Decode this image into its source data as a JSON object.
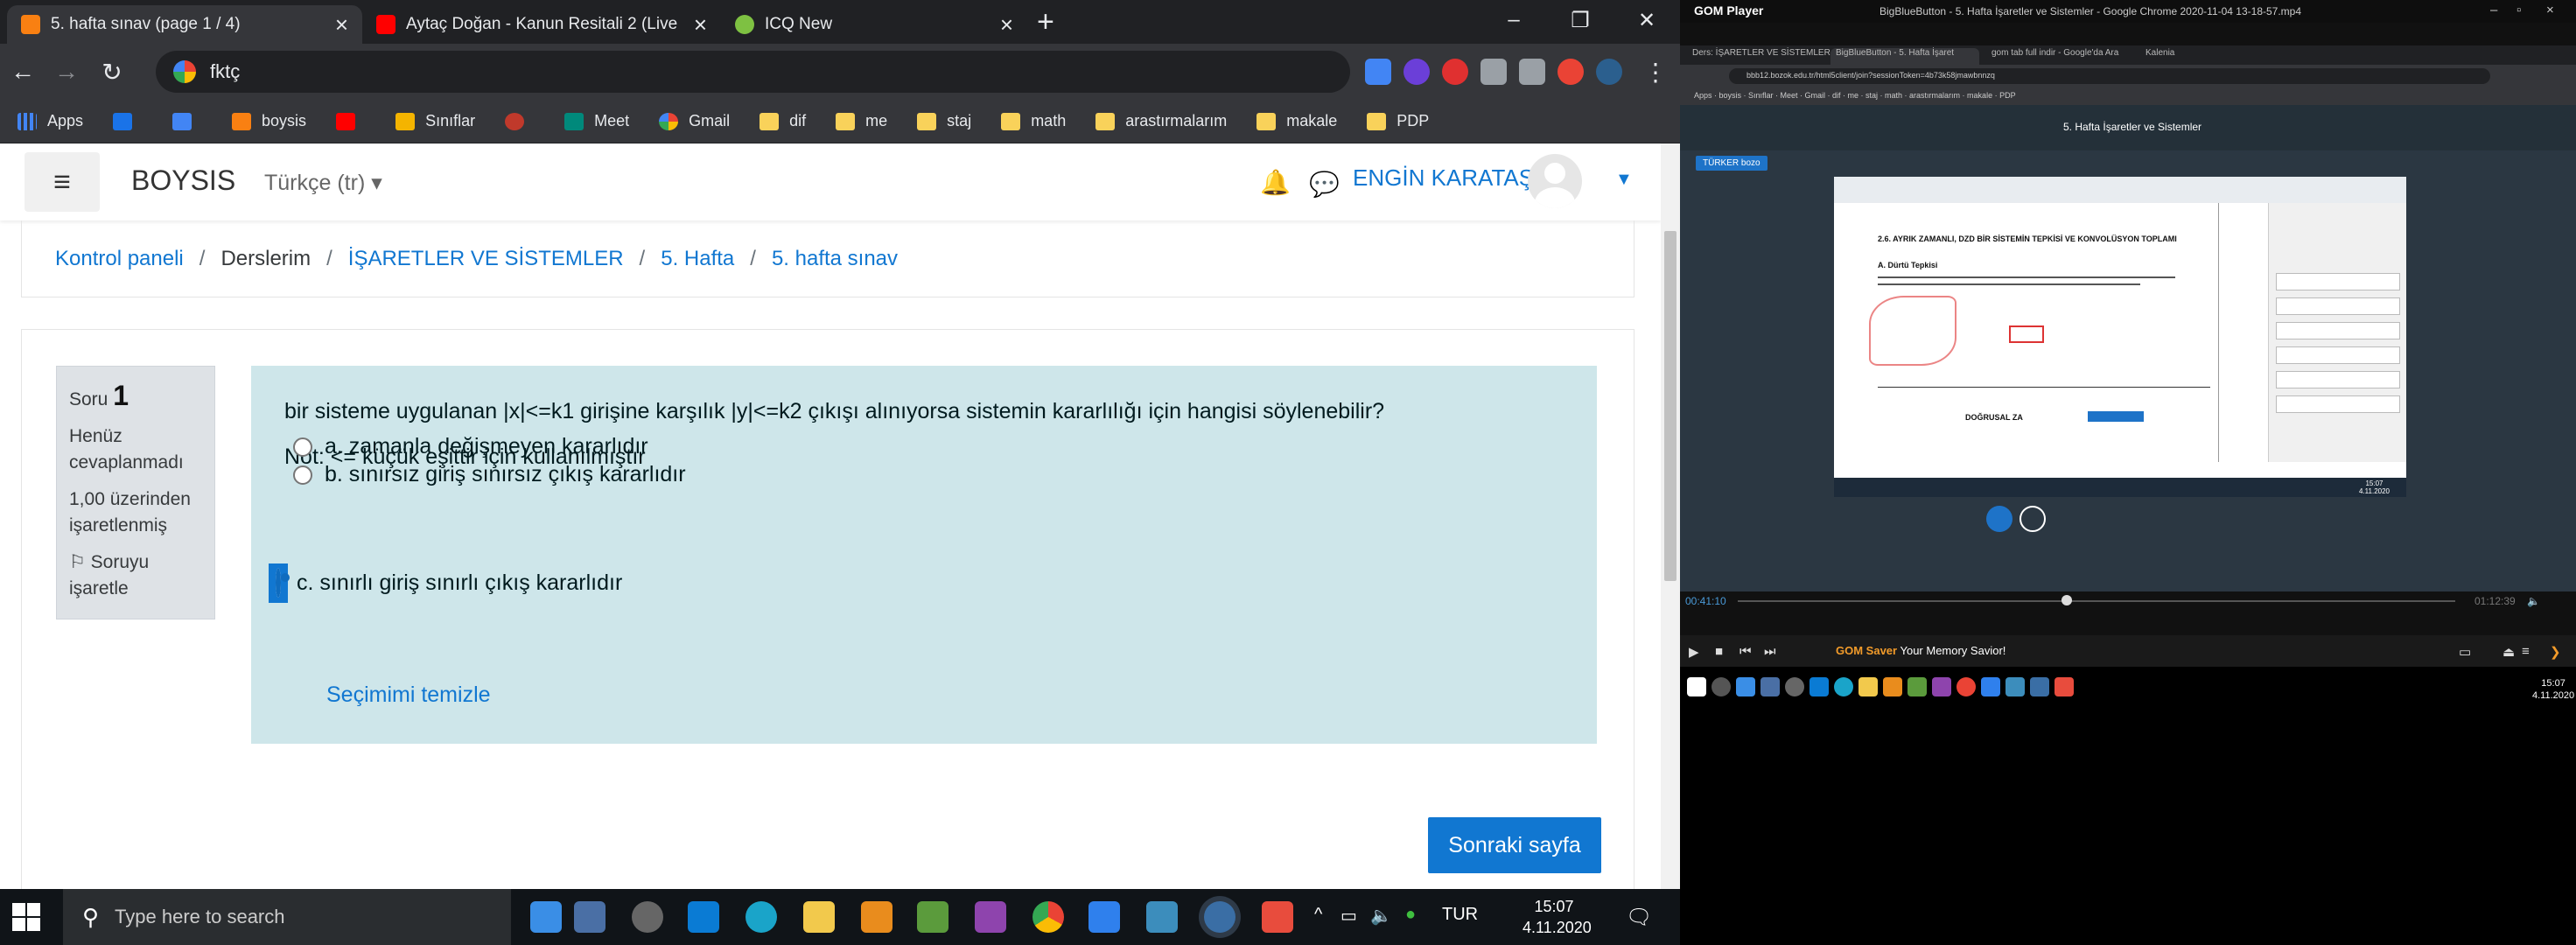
{
  "browser": {
    "tabs": [
      {
        "title": "5. hafta sınav (page 1 / 4)",
        "icon": "moodle-icon",
        "color": "#f98012"
      },
      {
        "title": "Aytaç Doğan - Kanun Resitali 2 (Live",
        "icon": "youtube-icon",
        "color": "#ff0000"
      },
      {
        "title": "ICQ New",
        "icon": "icq-icon",
        "color": "#7ec142"
      }
    ],
    "address": "fktç",
    "bookmarks": [
      {
        "label": "Apps",
        "icon": "apps-grid"
      },
      {
        "label": "",
        "icon": "magnet-icon"
      },
      {
        "label": "",
        "icon": "translate-icon"
      },
      {
        "label": "boysis",
        "icon": "moodle-icon"
      },
      {
        "label": "",
        "icon": "youtube-icon"
      },
      {
        "label": "Sınıflar",
        "icon": "classroom-icon"
      },
      {
        "label": "",
        "icon": "hand-icon"
      },
      {
        "label": "Meet",
        "icon": "meet-icon"
      },
      {
        "label": "Gmail",
        "icon": "google-icon"
      },
      {
        "label": "dif",
        "icon": "folder"
      },
      {
        "label": "me",
        "icon": "folder"
      },
      {
        "label": "staj",
        "icon": "folder"
      },
      {
        "label": "math",
        "icon": "folder"
      },
      {
        "label": "arastırmalarım",
        "icon": "folder"
      },
      {
        "label": "makale",
        "icon": "folder"
      },
      {
        "label": "PDP",
        "icon": "folder"
      }
    ]
  },
  "moodle": {
    "brand": "BOYSIS",
    "language": "Türkçe (tr)",
    "user": "ENGİN KARATAŞ",
    "breadcrumb": [
      {
        "label": "Kontrol paneli",
        "link": true
      },
      {
        "label": "Derslerim",
        "link": false
      },
      {
        "label": "İŞARETLER VE SİSTEMLER",
        "link": true
      },
      {
        "label": "5. Hafta",
        "link": true
      },
      {
        "label": "5. hafta sınav",
        "link": true
      }
    ],
    "question": {
      "soru_label": "Soru",
      "number": "1",
      "status": "Henüz cevaplanmadı",
      "marks": "1,00 üzerinden işaretlenmiş",
      "flag": "Soruyu işaretle",
      "text": "bir sisteme uygulanan |x|<=k1 girişine karşılık |y|<=k2 çıkışı alınıyorsa sistemin kararlılığı için hangisi söylenebilir?",
      "note": "Not: <= küçük eşittir için kullanılmıştır",
      "options": [
        {
          "label": "a. zamanla değişmeyen kararlıdır",
          "selected": false
        },
        {
          "label": "b. sınırsız giriş sınırsız çıkış kararlıdır",
          "selected": false
        },
        {
          "label": "c. sınırlı giriş sınırlı çıkış kararlıdır",
          "selected": true
        }
      ],
      "clear": "Seçimimi temizle"
    },
    "next_button": "Sonraki sayfa"
  },
  "taskbar": {
    "search_placeholder": "Type here to search",
    "language": "TUR",
    "time": "15:07",
    "date": "4.11.2020"
  },
  "gom": {
    "app_name": "GOM Player",
    "file_title": "BigBlueButton - 5. Hafta İşaretler ve Sistemler - Google Chrome 2020-11-04 13-18-57.mp4",
    "elapsed": "00:41:10",
    "total": "01:12:39",
    "saver_brand": "GOM Saver",
    "saver_text": "Your Memory Savior!",
    "video": {
      "tabs": [
        "Ders: İŞARETLER VE SİSTEMLER",
        "BigBlueButton - 5. Hafta İşaret",
        "gom tab full indir - Google'da Ara",
        "Kalenia"
      ],
      "url": "bbb12.bozok.edu.tr/html5client/join?sessionToken=4b73k58jmawbnnzq",
      "meeting_title": "5. Hafta İşaretler ve Sistemler",
      "presenter_tag": "TÜRKER bozo",
      "doc_heading": "2.6. AYRIK ZAMANLI, DZD BİR SİSTEMİN TEPKİSİ VE KONVOLÜSYON TOPLAMI",
      "doc_sub": "A. Dürtü Tepkisi",
      "doc_footer": "DOĞRUSAL ZA",
      "time": "15:07",
      "date": "4.11.2020"
    }
  }
}
